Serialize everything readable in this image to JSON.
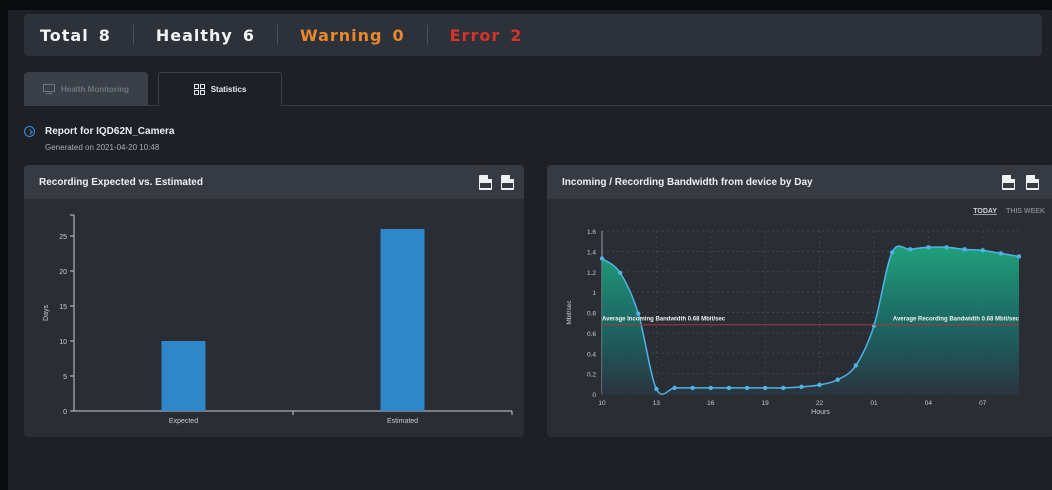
{
  "status": {
    "total_label": "Total",
    "total_value": "8",
    "healthy_label": "Healthy",
    "healthy_value": "6",
    "warning_label": "Warning",
    "warning_value": "0",
    "error_label": "Error",
    "error_value": "2"
  },
  "tabs": [
    {
      "label": "Health Monitoring",
      "icon": "monitor-icon",
      "active": false
    },
    {
      "label": "Statistics",
      "icon": "grid-icon",
      "active": true
    }
  ],
  "report": {
    "title": "Report for IQD62N_Camera",
    "generated": "Generated on 2021-04-20 10:48"
  },
  "panels": {
    "left_title": "Recording Expected vs. Estimated",
    "right_title": "Incoming / Recording Bandwidth from device by Day",
    "range_today": "TODAY",
    "range_week": "THIS WEEK"
  },
  "colors": {
    "warning": "#e8892b",
    "error": "#d6332b",
    "bar": "#2f86c8",
    "line": "#4fb3e6",
    "avg_line": "#a33a3a"
  },
  "chart_data": [
    {
      "type": "bar",
      "title": "Recording Expected vs. Estimated",
      "categories": [
        "Expected",
        "Estimated"
      ],
      "values": [
        10,
        26
      ],
      "xlabel": "",
      "ylabel": "Days",
      "ylim": [
        0,
        28
      ],
      "yticks": [
        0,
        5,
        10,
        15,
        20,
        25
      ]
    },
    {
      "type": "area",
      "title": "Incoming / Recording Bandwidth from device by Day",
      "xlabel": "Hours",
      "ylabel": "Mbit/sec",
      "ylim": [
        0,
        1.6
      ],
      "yticks": [
        "0",
        "0.2",
        "0.4",
        "0.6",
        "0.8",
        "1",
        "1.2",
        "1.4",
        "1.6"
      ],
      "xticks": [
        "10",
        "13",
        "16",
        "19",
        "22",
        "01",
        "04",
        "07"
      ],
      "x": [
        0,
        1,
        2,
        3,
        4,
        5,
        6,
        7,
        8,
        9,
        10,
        11,
        12,
        13,
        14,
        15,
        16,
        17,
        18,
        19,
        20,
        21,
        22,
        23
      ],
      "series": [
        {
          "values": [
            1.33,
            1.19,
            0.79,
            0.05,
            0.06,
            0.06,
            0.06,
            0.06,
            0.06,
            0.06,
            0.06,
            0.07,
            0.09,
            0.14,
            0.28,
            0.67,
            1.39,
            1.42,
            1.44,
            1.44,
            1.42,
            1.41,
            1.38,
            1.35
          ]
        }
      ],
      "avg_value": 0.68,
      "annotations": [
        "Average Incoming Bandwidth 0.68 Mbit/sec",
        "Average Recording Bandwidth 0.68 Mbit/sec"
      ]
    }
  ]
}
